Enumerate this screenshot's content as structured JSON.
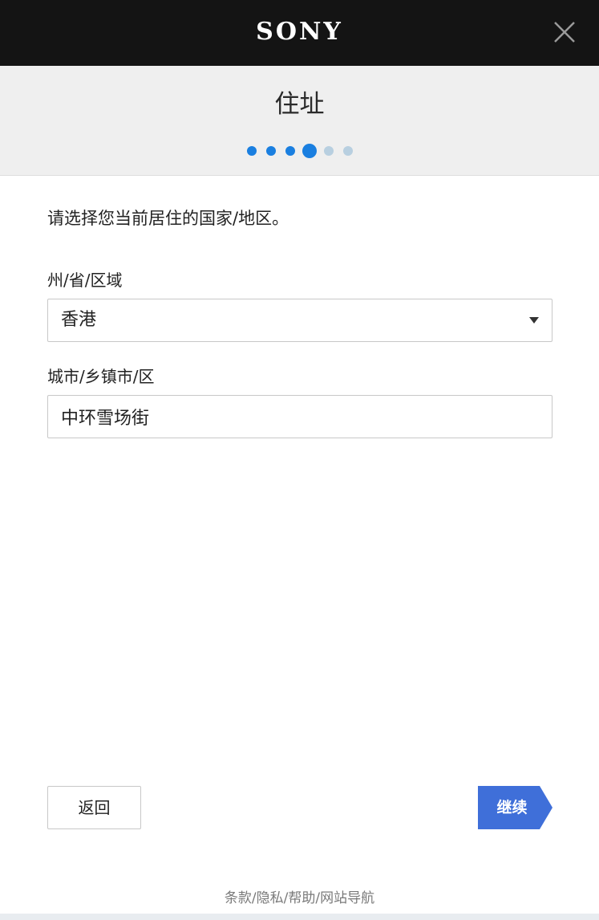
{
  "brand": {
    "logo_text": "SONY",
    "close_icon": "close-icon"
  },
  "header": {
    "title": "住址",
    "steps": {
      "total": 6,
      "current": 4,
      "completed_color": "#1a7fe0",
      "pending_color": "#b8cfe0"
    }
  },
  "form": {
    "prompt": "请选择您当前居住的国家/地区。",
    "state": {
      "label": "州/省/区域",
      "value": "香港"
    },
    "city": {
      "label": "城市/乡镇市/区",
      "value": "中环雪场街"
    }
  },
  "actions": {
    "back_label": "返回",
    "continue_label": "继续",
    "continue_color": "#3f6fd9"
  },
  "footer": {
    "terms": "条款",
    "privacy": "隐私",
    "help": "帮助",
    "sitemap": "网站导航",
    "separator": "/"
  },
  "colors": {
    "topbar": "#141414",
    "header_bg": "#efefef"
  }
}
